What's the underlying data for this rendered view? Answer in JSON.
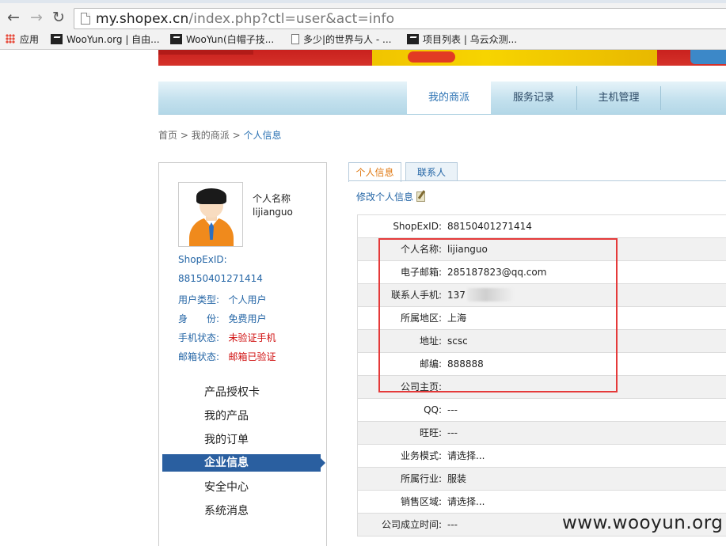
{
  "browser": {
    "url_host": "my.shopex.cn",
    "url_path": "/index.php?ctl=user&act=info",
    "bookmarks": [
      {
        "label": "应用",
        "icon": "apps-grid-icon"
      },
      {
        "label": "WooYun.org | 自由...",
        "icon": "wooyun-favicon-icon"
      },
      {
        "label": "WooYun(白帽子技...",
        "icon": "wooyun-favicon-icon"
      },
      {
        "label": "多少|的世界与人 - ...",
        "icon": "document-icon"
      },
      {
        "label": "项目列表 | 乌云众测...",
        "icon": "wooyun-favicon-icon"
      }
    ]
  },
  "nav": {
    "tabs": [
      {
        "label": "我的商派"
      },
      {
        "label": "服务记录"
      },
      {
        "label": "主机管理"
      }
    ]
  },
  "breadcrumb": {
    "home": "首页",
    "sep": ">",
    "level1": "我的商派",
    "current": "个人信息"
  },
  "profile": {
    "name_label": "个人名称",
    "name_value": "lijianguo",
    "shopex_id_label": "ShopExID:",
    "shopex_id_value": "88150401271414",
    "user_type_label": "用户类型:",
    "user_type_value": "个人用户",
    "identity_label": "身　　份:",
    "identity_value": "免费用户",
    "phone_status_label": "手机状态:",
    "phone_status_value": "未验证手机",
    "email_status_label": "邮箱状态:",
    "email_status_value": "邮箱已验证"
  },
  "side_menu": {
    "items": [
      {
        "label": "产品授权卡"
      },
      {
        "label": "我的产品"
      },
      {
        "label": "我的订单"
      },
      {
        "label": "企业信息"
      },
      {
        "label": "安全中心"
      },
      {
        "label": "系统消息"
      }
    ],
    "active_index": 3
  },
  "content": {
    "tabs": [
      {
        "label": "个人信息"
      },
      {
        "label": "联系人"
      }
    ],
    "edit_link": "修改个人信息",
    "rows": [
      {
        "label": "ShopExID:",
        "value": "88150401271414"
      },
      {
        "label": "个人名称:",
        "value": "lijianguo"
      },
      {
        "label": "电子邮箱:",
        "value": "285187823@qq.com"
      },
      {
        "label": "联系人手机:",
        "value": "137"
      },
      {
        "label": "所属地区:",
        "value": "上海"
      },
      {
        "label": "地址:",
        "value": "scsc"
      },
      {
        "label": "邮编:",
        "value": "888888"
      },
      {
        "label": "公司主页:",
        "value": ""
      },
      {
        "label": "QQ:",
        "value": "---"
      },
      {
        "label": "旺旺:",
        "value": "---"
      },
      {
        "label": "业务模式:",
        "value": "请选择..."
      },
      {
        "label": "所属行业:",
        "value": "服装"
      },
      {
        "label": "销售区域:",
        "value": "请选择..."
      },
      {
        "label": "公司成立时间:",
        "value": "---"
      }
    ]
  },
  "watermark": "www.wooyun.org",
  "colors": {
    "link_blue": "#2566a6",
    "active_menu": "#2a5fa0",
    "warning_red": "#d01010",
    "highlight_red": "#e53a3a",
    "active_tab_orange": "#e07a14"
  }
}
